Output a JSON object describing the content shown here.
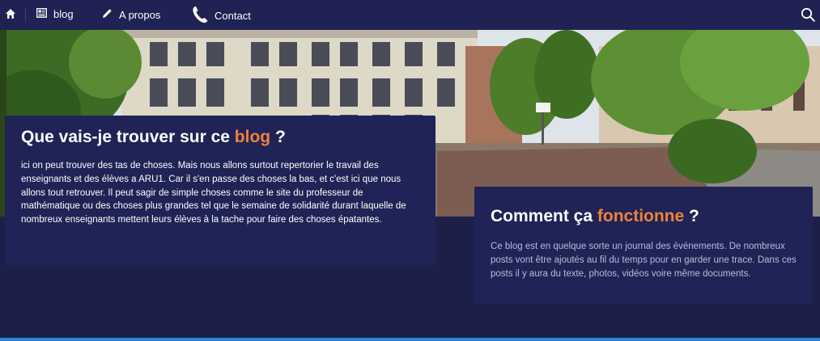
{
  "nav": {
    "home_icon": "home-icon",
    "blog_label": "blog",
    "apropos_label": "A propos",
    "contact_label": "Contact",
    "search_icon": "search-icon"
  },
  "card1": {
    "title_prefix": "Que vais-je trouver sur ce ",
    "title_accent": "blog",
    "title_suffix": " ?",
    "body": "ici on peut trouver des tas de choses. Mais nous allons surtout repertorier le travail des enseignants et des élèves a ARU1. Car il s'en passe des choses la bas, et c'est ici que nous allons tout retrouver. Il peut sagir de simple choses comme le site du professeur de mathématique ou des choses plus grandes tel que le semaine de solidarité durant laquelle de nombreux enseignants mettent leurs élèves à la tache pour faire des choses épatantes."
  },
  "card2": {
    "title_prefix": "Comment ça ",
    "title_accent": "fonctionne",
    "title_suffix": " ?",
    "body": "Ce blog est en quelque sorte un journal des événements. De nombreux posts vont être ajoutés au fil du temps pour en garder une trace. Dans ces posts il y aura du texte, photos, vidéos voire même documents."
  },
  "colors": {
    "nav_bg": "#1f2252",
    "page_bg": "#1c1f48",
    "card_bg": "#1f2355",
    "accent": "#f0813a",
    "bottom_line": "#2a86d8"
  }
}
